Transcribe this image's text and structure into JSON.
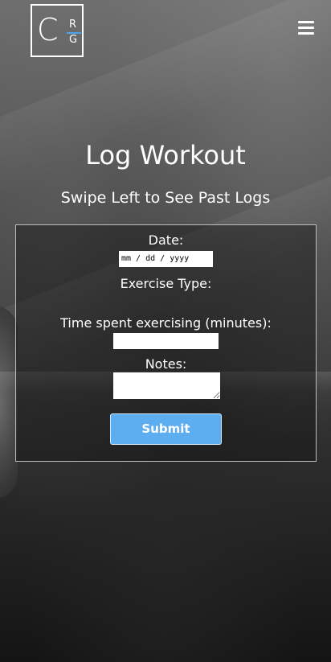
{
  "header": {
    "logo": {
      "letter_c": "C",
      "letter_r": "R",
      "letter_g": "G",
      "accent_color": "#4ea3ee"
    },
    "menu_icon": "hamburger-menu-icon"
  },
  "main": {
    "title": "Log Workout",
    "subtitle": "Swipe Left to See Past Logs"
  },
  "form": {
    "date_label": "Date:",
    "date_placeholder": "mm / dd / yyyy",
    "exercise_type_label": "Exercise Type:",
    "time_label": "Time spent exercising (minutes):",
    "time_value": "",
    "notes_label": "Notes:",
    "notes_value": "",
    "submit_label": "Submit",
    "submit_color": "#5daef0"
  }
}
